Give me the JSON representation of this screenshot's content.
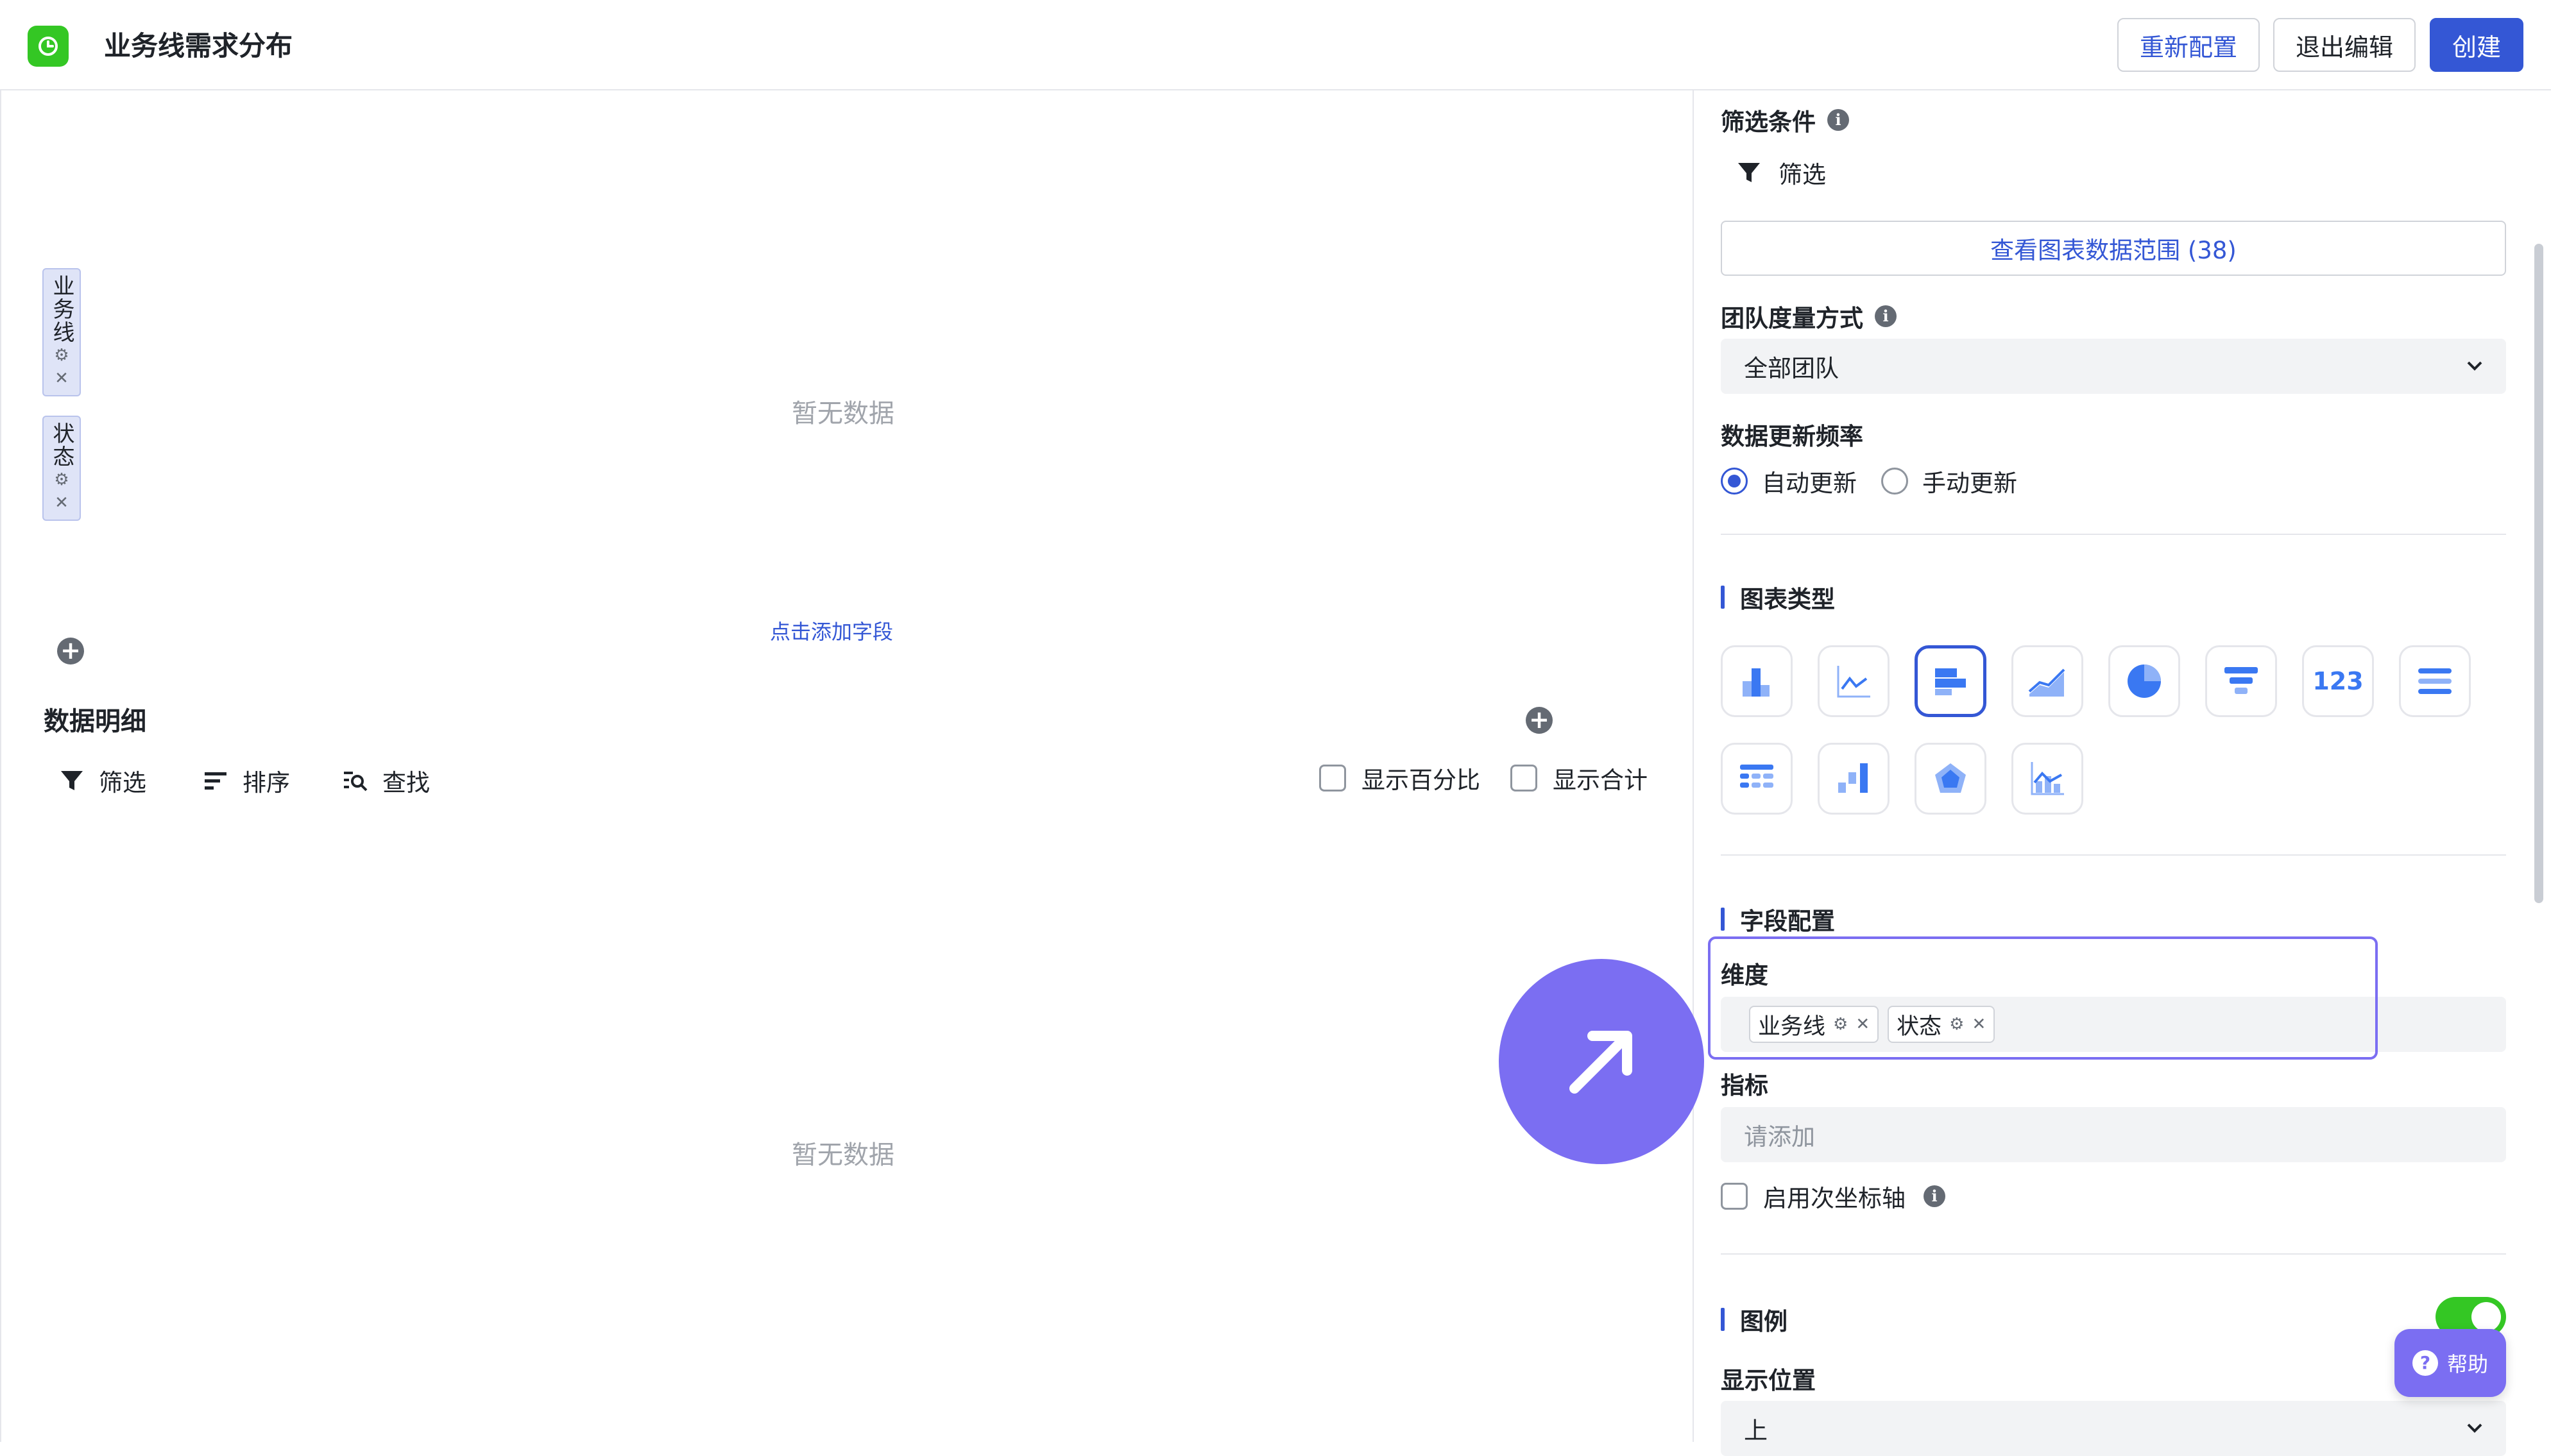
{
  "header": {
    "title": "业务线需求分布",
    "reconfigure_label": "重新配置",
    "exit_edit_label": "退出编辑",
    "create_label": "创建"
  },
  "canvas": {
    "vertical_chips": [
      {
        "label": "业务线"
      },
      {
        "label": "状态"
      }
    ],
    "empty_text_top": "暂无数据",
    "add_field_label": "点击添加字段"
  },
  "detail": {
    "title": "数据明细",
    "filter_label": "筛选",
    "sort_label": "排序",
    "find_label": "查找",
    "show_percent_label": "显示百分比",
    "show_total_label": "显示合计",
    "empty_text": "暂无数据"
  },
  "panel": {
    "filter_conditions_label": "筛选条件",
    "filter_label": "筛选",
    "view_range_label": "查看图表数据范围 (38)",
    "team_metric_label": "团队度量方式",
    "team_metric_value": "全部团队",
    "update_freq_label": "数据更新频率",
    "update_auto_label": "自动更新",
    "update_manual_label": "手动更新",
    "chart_type_label": "图表类型",
    "chart_types": [
      "bar-chart-icon",
      "line-chart-icon",
      "horizontal-bar-chart-icon",
      "area-chart-icon",
      "pie-chart-icon",
      "funnel-chart-icon",
      "number-card-icon",
      "list-chart-icon",
      "table-chart-icon",
      "waterfall-chart-icon",
      "radar-chart-icon",
      "combo-chart-icon"
    ],
    "number_card_text": "123",
    "selected_chart_type": "horizontal-bar-chart-icon",
    "field_config_label": "字段配置",
    "dimension_label": "维度",
    "dimension_tags": [
      "业务线",
      "状态"
    ],
    "metric_label": "指标",
    "metric_placeholder": "请添加",
    "secondary_axis_label": "启用次坐标轴",
    "legend_label": "图例",
    "legend_enabled": true,
    "position_label": "显示位置",
    "position_value": "上",
    "help_label": "帮助"
  },
  "colors": {
    "accent": "#3457d5",
    "brand_green": "#34c724",
    "highlight_purple": "#7b6ef2"
  }
}
